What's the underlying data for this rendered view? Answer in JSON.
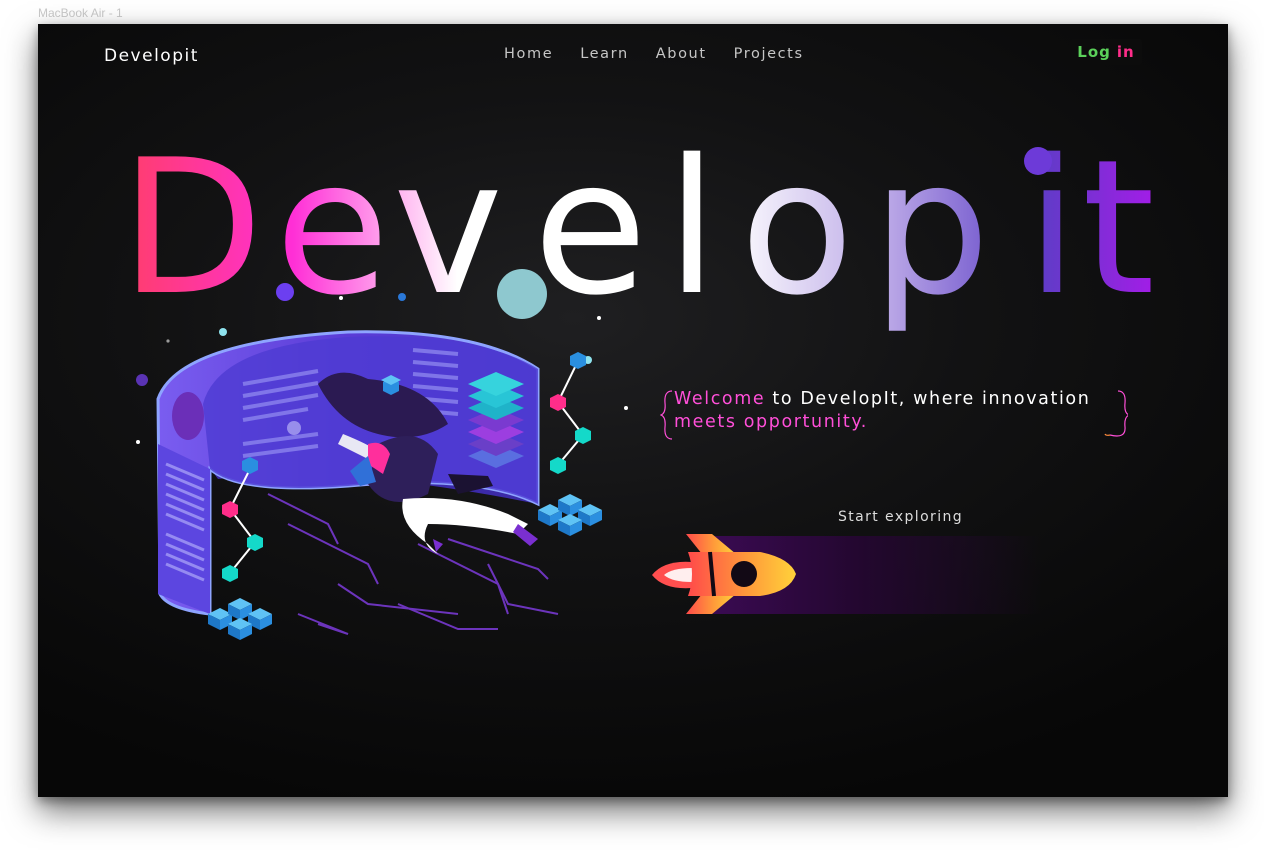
{
  "canvas": {
    "frame_label": "MacBook Air - 1"
  },
  "header": {
    "brand": "Developit",
    "nav": [
      {
        "label": "Home"
      },
      {
        "label": "Learn"
      },
      {
        "label": "About"
      },
      {
        "label": "Projects"
      }
    ],
    "login": {
      "word1": "Log",
      "word2": "in"
    }
  },
  "hero": {
    "letters": [
      "D",
      "e",
      "v",
      "e",
      "l",
      "o",
      "p",
      "i",
      "t"
    ],
    "welcome_line1_a": "Welcome",
    "welcome_line1_b": " to DevelopIt, where innovation",
    "welcome_line2": "meets opportunity.",
    "cta_label": "Start exploring"
  },
  "icons": {
    "rocket": "rocket-icon",
    "illustration": "developer-illustration"
  },
  "colors": {
    "title_gradient": [
      "#ff3d7a",
      "#ff2fd4",
      "#ffffff",
      "#ffffff",
      "#5b3ec5",
      "#9b1fe8"
    ],
    "login_green": "#5bd15a",
    "login_pink": "#ff2d8a",
    "welcome_pink": "#ff4fd8",
    "rocket_orange": "#ff6a3d",
    "rocket_yellow": "#ffc83a"
  }
}
